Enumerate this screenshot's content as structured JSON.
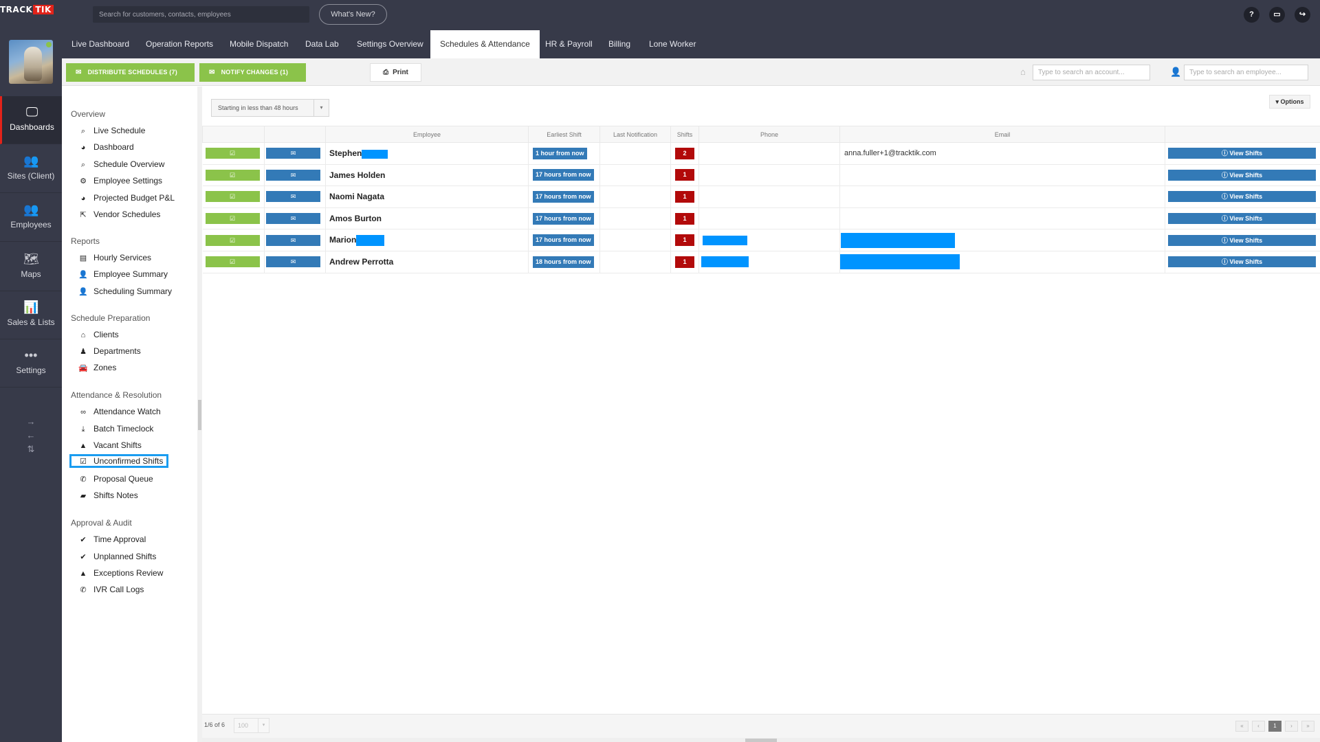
{
  "brand": {
    "logo_part1": "TRACK",
    "logo_part2": "TIK"
  },
  "topbar": {
    "search_placeholder": "Search for customers, contacts, employees",
    "whats_new": "What's New?",
    "icons": [
      "help-icon",
      "monitor-icon",
      "share-icon"
    ],
    "help_label": "?",
    "monitor_label": "▭",
    "share_label": "↪"
  },
  "rail": {
    "items": [
      {
        "label": "Dashboards",
        "icon": "monitor-icon",
        "glyph": "🖵"
      },
      {
        "label": "Sites (Client)",
        "icon": "people-icon",
        "glyph": "👥"
      },
      {
        "label": "Employees",
        "icon": "people-icon",
        "glyph": "👥"
      },
      {
        "label": "Maps",
        "icon": "map-icon",
        "glyph": "🗺"
      },
      {
        "label": "Sales & Lists",
        "icon": "chart-icon",
        "glyph": "📊"
      },
      {
        "label": "Settings",
        "icon": "dots-icon",
        "glyph": "•••"
      }
    ],
    "arrows": [
      "→",
      "←",
      "⇅"
    ]
  },
  "nav": {
    "tabs": [
      {
        "label": "Live Dashboard"
      },
      {
        "label": "Operation Reports"
      },
      {
        "label": "Mobile Dispatch"
      },
      {
        "label": "Data Lab"
      },
      {
        "label": "Settings Overview"
      },
      {
        "label": "Schedules & Attendance",
        "active": true
      },
      {
        "label": "HR & Payroll"
      },
      {
        "label": "Billing"
      },
      {
        "label": "Lone Worker"
      }
    ]
  },
  "toolbar": {
    "distribute": "DISTRIBUTE SCHEDULES (7)",
    "notify": "NOTIFY CHANGES (1)",
    "print": "Print",
    "account_placeholder": "Type to search an account...",
    "employee_placeholder": "Type to search an employee..."
  },
  "submenu": {
    "sections": [
      {
        "title": "Overview",
        "items": [
          {
            "label": "Live Schedule",
            "icon": "search-icon",
            "glyph": "⌕"
          },
          {
            "label": "Dashboard",
            "icon": "pie-chart-icon",
            "glyph": "◕"
          },
          {
            "label": "Schedule Overview",
            "icon": "search-icon",
            "glyph": "⌕"
          },
          {
            "label": "Employee Settings",
            "icon": "gear-icon",
            "glyph": "⚙"
          },
          {
            "label": "Projected Budget P&L",
            "icon": "pie-chart-icon",
            "glyph": "◕"
          },
          {
            "label": "Vendor Schedules",
            "icon": "external-link-icon",
            "glyph": "⇱"
          }
        ]
      },
      {
        "title": "Reports",
        "items": [
          {
            "label": "Hourly Services",
            "icon": "document-icon",
            "glyph": "▤"
          },
          {
            "label": "Employee Summary",
            "icon": "user-icon",
            "glyph": "👤"
          },
          {
            "label": "Scheduling Summary",
            "icon": "user-icon",
            "glyph": "👤"
          }
        ]
      },
      {
        "title": "Schedule Preparation",
        "items": [
          {
            "label": "Clients",
            "icon": "home-icon",
            "glyph": "⌂"
          },
          {
            "label": "Departments",
            "icon": "department-icon",
            "glyph": "♟"
          },
          {
            "label": "Zones",
            "icon": "car-icon",
            "glyph": "🚘"
          }
        ]
      },
      {
        "title": "Attendance & Resolution",
        "items": [
          {
            "label": "Attendance Watch",
            "icon": "glasses-icon",
            "glyph": "∞"
          },
          {
            "label": "Batch Timeclock",
            "icon": "download-icon",
            "glyph": "⤓"
          },
          {
            "label": "Vacant Shifts",
            "icon": "warning-icon",
            "glyph": "▲"
          },
          {
            "label": "Unconfirmed Shifts",
            "icon": "checkbox-icon",
            "glyph": "☑",
            "highlight": true
          },
          {
            "label": "Proposal Queue",
            "icon": "phone-icon",
            "glyph": "✆"
          },
          {
            "label": "Shifts Notes",
            "icon": "folder-icon",
            "glyph": "▰"
          }
        ]
      },
      {
        "title": "Approval & Audit",
        "items": [
          {
            "label": "Time Approval",
            "icon": "check-icon",
            "glyph": "✔"
          },
          {
            "label": "Unplanned Shifts",
            "icon": "check-icon",
            "glyph": "✔"
          },
          {
            "label": "Exceptions Review",
            "icon": "warning-icon",
            "glyph": "▲"
          },
          {
            "label": "IVR Call Logs",
            "icon": "phone-icon",
            "glyph": "✆"
          }
        ]
      }
    ]
  },
  "content": {
    "filter": "Starting in less than 48 hours",
    "options": "▾ Options",
    "columns": [
      "",
      "",
      "Employee",
      "Earliest Shift",
      "Last Notification",
      "Shifts",
      "Phone",
      "Email",
      ""
    ],
    "view_shifts_label": "ⓘ View Shifts",
    "rows": [
      {
        "name": "Stephen",
        "earliest": "1 hour from now",
        "last": "",
        "shifts": "2",
        "email": "anna.fuller+1@tracktik.com"
      },
      {
        "name": "James Holden",
        "earliest": "17 hours from now",
        "last": "",
        "shifts": "1",
        "email": ""
      },
      {
        "name": "Naomi Nagata",
        "earliest": "17 hours from now",
        "last": "",
        "shifts": "1",
        "email": ""
      },
      {
        "name": "Amos Burton",
        "earliest": "17 hours from now",
        "last": "",
        "shifts": "1",
        "email": ""
      },
      {
        "name": "Marion",
        "earliest": "17 hours from now",
        "last": "",
        "shifts": "1",
        "email": ""
      },
      {
        "name": "Andrew Perrotta",
        "earliest": "18 hours from now",
        "last": "",
        "shifts": "1",
        "email": ""
      }
    ]
  },
  "footer": {
    "count": "1/6 of 6",
    "per_page": "100",
    "pages": [
      "«",
      "‹",
      "1",
      "›",
      "»"
    ]
  },
  "colors": {
    "accent_green": "#8bc34a",
    "accent_blue": "#337ab7",
    "shift_red": "#b20a0a",
    "highlight": "#1a9cf0",
    "dark_nav": "#373a49"
  }
}
